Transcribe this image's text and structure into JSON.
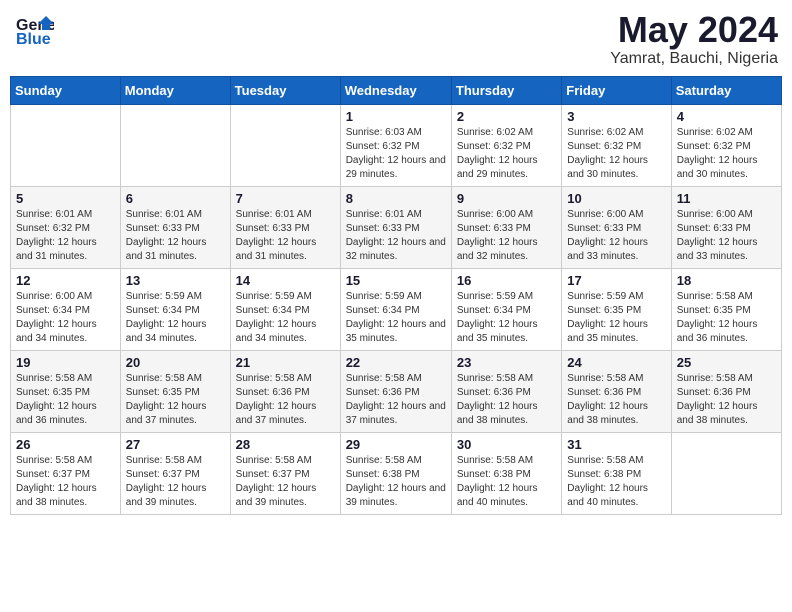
{
  "logo": {
    "general": "General",
    "blue": "Blue"
  },
  "title": {
    "month_year": "May 2024",
    "location": "Yamrat, Bauchi, Nigeria"
  },
  "days_of_week": [
    "Sunday",
    "Monday",
    "Tuesday",
    "Wednesday",
    "Thursday",
    "Friday",
    "Saturday"
  ],
  "weeks": [
    [
      {
        "day": "",
        "sunrise": "",
        "sunset": "",
        "daylight": ""
      },
      {
        "day": "",
        "sunrise": "",
        "sunset": "",
        "daylight": ""
      },
      {
        "day": "",
        "sunrise": "",
        "sunset": "",
        "daylight": ""
      },
      {
        "day": "1",
        "sunrise": "Sunrise: 6:03 AM",
        "sunset": "Sunset: 6:32 PM",
        "daylight": "Daylight: 12 hours and 29 minutes."
      },
      {
        "day": "2",
        "sunrise": "Sunrise: 6:02 AM",
        "sunset": "Sunset: 6:32 PM",
        "daylight": "Daylight: 12 hours and 29 minutes."
      },
      {
        "day": "3",
        "sunrise": "Sunrise: 6:02 AM",
        "sunset": "Sunset: 6:32 PM",
        "daylight": "Daylight: 12 hours and 30 minutes."
      },
      {
        "day": "4",
        "sunrise": "Sunrise: 6:02 AM",
        "sunset": "Sunset: 6:32 PM",
        "daylight": "Daylight: 12 hours and 30 minutes."
      }
    ],
    [
      {
        "day": "5",
        "sunrise": "Sunrise: 6:01 AM",
        "sunset": "Sunset: 6:32 PM",
        "daylight": "Daylight: 12 hours and 31 minutes."
      },
      {
        "day": "6",
        "sunrise": "Sunrise: 6:01 AM",
        "sunset": "Sunset: 6:33 PM",
        "daylight": "Daylight: 12 hours and 31 minutes."
      },
      {
        "day": "7",
        "sunrise": "Sunrise: 6:01 AM",
        "sunset": "Sunset: 6:33 PM",
        "daylight": "Daylight: 12 hours and 31 minutes."
      },
      {
        "day": "8",
        "sunrise": "Sunrise: 6:01 AM",
        "sunset": "Sunset: 6:33 PM",
        "daylight": "Daylight: 12 hours and 32 minutes."
      },
      {
        "day": "9",
        "sunrise": "Sunrise: 6:00 AM",
        "sunset": "Sunset: 6:33 PM",
        "daylight": "Daylight: 12 hours and 32 minutes."
      },
      {
        "day": "10",
        "sunrise": "Sunrise: 6:00 AM",
        "sunset": "Sunset: 6:33 PM",
        "daylight": "Daylight: 12 hours and 33 minutes."
      },
      {
        "day": "11",
        "sunrise": "Sunrise: 6:00 AM",
        "sunset": "Sunset: 6:33 PM",
        "daylight": "Daylight: 12 hours and 33 minutes."
      }
    ],
    [
      {
        "day": "12",
        "sunrise": "Sunrise: 6:00 AM",
        "sunset": "Sunset: 6:34 PM",
        "daylight": "Daylight: 12 hours and 34 minutes."
      },
      {
        "day": "13",
        "sunrise": "Sunrise: 5:59 AM",
        "sunset": "Sunset: 6:34 PM",
        "daylight": "Daylight: 12 hours and 34 minutes."
      },
      {
        "day": "14",
        "sunrise": "Sunrise: 5:59 AM",
        "sunset": "Sunset: 6:34 PM",
        "daylight": "Daylight: 12 hours and 34 minutes."
      },
      {
        "day": "15",
        "sunrise": "Sunrise: 5:59 AM",
        "sunset": "Sunset: 6:34 PM",
        "daylight": "Daylight: 12 hours and 35 minutes."
      },
      {
        "day": "16",
        "sunrise": "Sunrise: 5:59 AM",
        "sunset": "Sunset: 6:34 PM",
        "daylight": "Daylight: 12 hours and 35 minutes."
      },
      {
        "day": "17",
        "sunrise": "Sunrise: 5:59 AM",
        "sunset": "Sunset: 6:35 PM",
        "daylight": "Daylight: 12 hours and 35 minutes."
      },
      {
        "day": "18",
        "sunrise": "Sunrise: 5:58 AM",
        "sunset": "Sunset: 6:35 PM",
        "daylight": "Daylight: 12 hours and 36 minutes."
      }
    ],
    [
      {
        "day": "19",
        "sunrise": "Sunrise: 5:58 AM",
        "sunset": "Sunset: 6:35 PM",
        "daylight": "Daylight: 12 hours and 36 minutes."
      },
      {
        "day": "20",
        "sunrise": "Sunrise: 5:58 AM",
        "sunset": "Sunset: 6:35 PM",
        "daylight": "Daylight: 12 hours and 37 minutes."
      },
      {
        "day": "21",
        "sunrise": "Sunrise: 5:58 AM",
        "sunset": "Sunset: 6:36 PM",
        "daylight": "Daylight: 12 hours and 37 minutes."
      },
      {
        "day": "22",
        "sunrise": "Sunrise: 5:58 AM",
        "sunset": "Sunset: 6:36 PM",
        "daylight": "Daylight: 12 hours and 37 minutes."
      },
      {
        "day": "23",
        "sunrise": "Sunrise: 5:58 AM",
        "sunset": "Sunset: 6:36 PM",
        "daylight": "Daylight: 12 hours and 38 minutes."
      },
      {
        "day": "24",
        "sunrise": "Sunrise: 5:58 AM",
        "sunset": "Sunset: 6:36 PM",
        "daylight": "Daylight: 12 hours and 38 minutes."
      },
      {
        "day": "25",
        "sunrise": "Sunrise: 5:58 AM",
        "sunset": "Sunset: 6:36 PM",
        "daylight": "Daylight: 12 hours and 38 minutes."
      }
    ],
    [
      {
        "day": "26",
        "sunrise": "Sunrise: 5:58 AM",
        "sunset": "Sunset: 6:37 PM",
        "daylight": "Daylight: 12 hours and 38 minutes."
      },
      {
        "day": "27",
        "sunrise": "Sunrise: 5:58 AM",
        "sunset": "Sunset: 6:37 PM",
        "daylight": "Daylight: 12 hours and 39 minutes."
      },
      {
        "day": "28",
        "sunrise": "Sunrise: 5:58 AM",
        "sunset": "Sunset: 6:37 PM",
        "daylight": "Daylight: 12 hours and 39 minutes."
      },
      {
        "day": "29",
        "sunrise": "Sunrise: 5:58 AM",
        "sunset": "Sunset: 6:38 PM",
        "daylight": "Daylight: 12 hours and 39 minutes."
      },
      {
        "day": "30",
        "sunrise": "Sunrise: 5:58 AM",
        "sunset": "Sunset: 6:38 PM",
        "daylight": "Daylight: 12 hours and 40 minutes."
      },
      {
        "day": "31",
        "sunrise": "Sunrise: 5:58 AM",
        "sunset": "Sunset: 6:38 PM",
        "daylight": "Daylight: 12 hours and 40 minutes."
      },
      {
        "day": "",
        "sunrise": "",
        "sunset": "",
        "daylight": ""
      }
    ]
  ]
}
